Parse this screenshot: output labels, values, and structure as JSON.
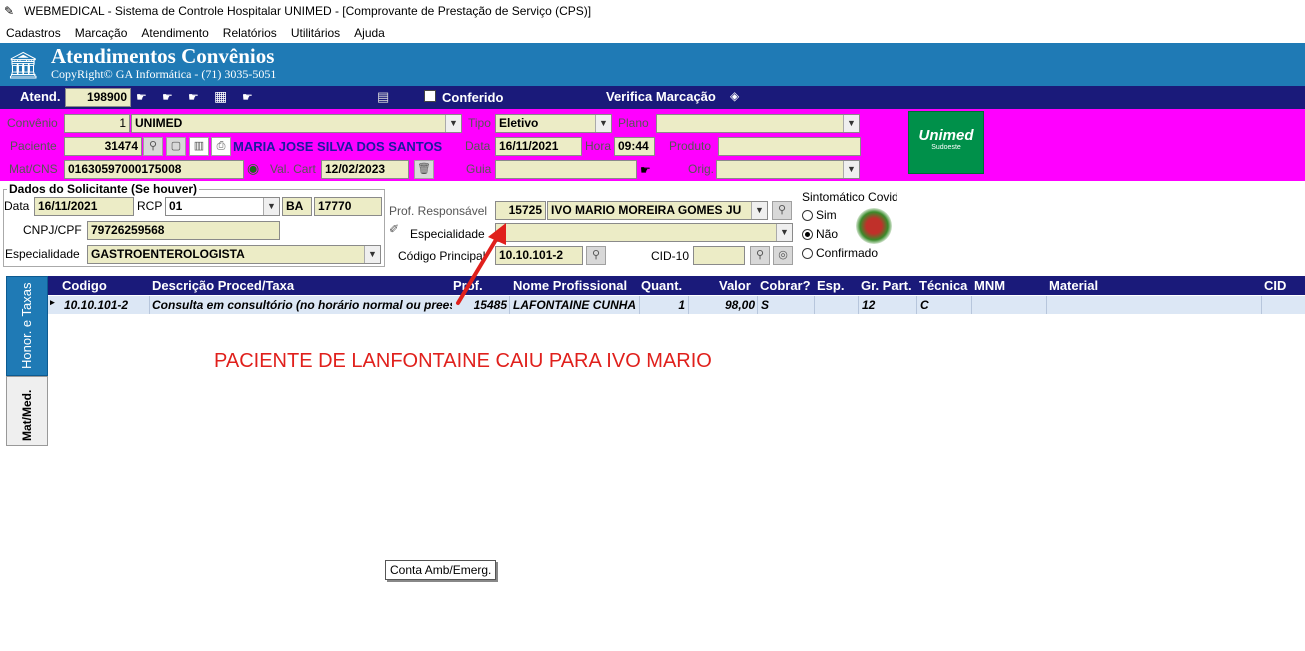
{
  "window": {
    "title": "WEBMEDICAL - Sistema de Controle Hospitalar UNIMED - [Comprovante de Prestação de Serviço  (CPS)]"
  },
  "menu": [
    "Cadastros",
    "Marcação",
    "Atendimento",
    "Relatórios",
    "Utilitários",
    "Ajuda"
  ],
  "banner": {
    "title": "Atendimentos Convênios",
    "copyright": "CopyRight© GA Informática - (71) 3035-5051"
  },
  "nav": {
    "atend_label": "Atend.",
    "atend_value": "198900",
    "conferido_label": "Conferido",
    "verifica_label": "Verifica Marcação"
  },
  "header": {
    "convenio_label": "Convênio",
    "convenio_code": "1",
    "convenio_name": "UNIMED",
    "tipo_label": "Tipo",
    "tipo_value": "Eletivo",
    "plano_label": "Plano",
    "plano_value": "",
    "paciente_label": "Paciente",
    "paciente_code": "31474",
    "paciente_name": "MARIA JOSE SILVA DOS SANTOS",
    "data_label": "Data",
    "data_value": "16/11/2021",
    "hora_label": "Hora",
    "hora_value": "09:44",
    "produto_label": "Produto",
    "produto_value": "",
    "matcns_label": "Mat/CNS",
    "matcns_value": "01630597000175008",
    "valcart_label": "Val. Cart",
    "valcart_value": "12/02/2023",
    "guia_label": "Guia",
    "guia_value": "",
    "orig_label": "Orig.",
    "orig_value": "",
    "logo_text": "Unimed",
    "logo_sub": "Sudoeste"
  },
  "solicitante": {
    "section_title": "Dados do Solicitante (Se houver)",
    "data_label": "Data",
    "data_value": "16/11/2021",
    "rcp_label": "RCP",
    "rcp_value": "01",
    "uf_value": "BA",
    "num_value": "17770",
    "cnpj_label": "CNPJ/CPF",
    "cnpj_value": "79726259568",
    "esp_label": "Especialidade",
    "esp_value": "GASTROENTEROLOGISTA"
  },
  "profissional": {
    "resp_label": "Prof. Responsável",
    "resp_code": "15725",
    "resp_name": "IVO MARIO MOREIRA GOMES JU",
    "esp_label": "Especialidade",
    "esp_value": "",
    "codigo_label": "Código Principal",
    "codigo_value": "10.10.101-2",
    "cid_label": "CID-10",
    "cid_value": ""
  },
  "covid": {
    "title": "Sintomático Covid",
    "options": [
      "Sim",
      "Não",
      "Confirmado"
    ],
    "selected": "Não"
  },
  "tabs": {
    "tab1": "Honor. e Taxas",
    "tab2": "Mat/Med."
  },
  "grid": {
    "columns": [
      "Codigo",
      "Descrição Proced/Taxa",
      "Prof.",
      "Nome Profissional",
      "Quant.",
      "Valor",
      "Cobrar?",
      "Esp.",
      "Gr. Part.",
      "Técnica",
      "MNM",
      "Material",
      "CID"
    ],
    "rows": [
      {
        "codigo": "10.10.101-2",
        "descricao": "Consulta em consultório (no horário normal ou prees",
        "prof": "15485",
        "nome": "LAFONTAINE CUNHA",
        "quant": "1",
        "valor": "98,00",
        "cobrar": "S",
        "esp": "",
        "grpart": "12",
        "tecnica": "C",
        "mnm": "",
        "material": "",
        "cid": ""
      }
    ]
  },
  "annotation": "PACIENTE DE LANFONTAINE CAIU PARA IVO MARIO",
  "tooltip": "Conta Amb/Emerg.",
  "colors": {
    "banner": "#1f7ab5",
    "nav": "#1a1a7a",
    "magenta": "#ff00ff",
    "field": "#ececc6",
    "unimed": "#00904a",
    "annotation": "#e0201c"
  }
}
